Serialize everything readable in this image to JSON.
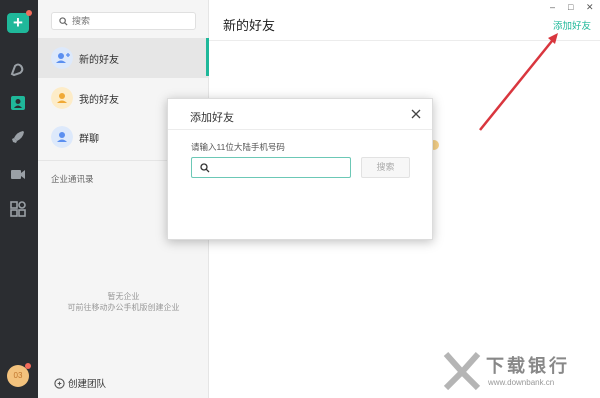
{
  "rail": {
    "icons": [
      "plus-icon",
      "chat-icon",
      "contacts-icon",
      "rocket-icon",
      "video-icon",
      "apps-icon",
      "user-avatar"
    ],
    "avatar_text": "03"
  },
  "sidebar": {
    "search_placeholder": "搜索",
    "items": [
      {
        "label": "新的好友",
        "icon": "add-user-icon"
      },
      {
        "label": "我的好友",
        "icon": "user-icon"
      },
      {
        "label": "群聊",
        "icon": "group-icon"
      }
    ],
    "section_title": "企业通讯录",
    "empty_title": "暂无企业",
    "empty_hint": "可前往移动办公手机版创建企业",
    "create_team": "创建团队"
  },
  "main": {
    "title": "新的好友",
    "add_friend_link": "添加好友",
    "window_controls": [
      "–",
      "□",
      "✕"
    ]
  },
  "dialog": {
    "title": "添加好友",
    "prompt": "请输入11位大陆手机号码",
    "input_value": "",
    "search_button": "搜索"
  },
  "watermark": {
    "name": "下载银行",
    "url": "www.downbank.cn"
  },
  "colors": {
    "accent": "#1fb89a",
    "rail_bg": "#2b2d31",
    "annotation_arrow": "#d9363e"
  }
}
